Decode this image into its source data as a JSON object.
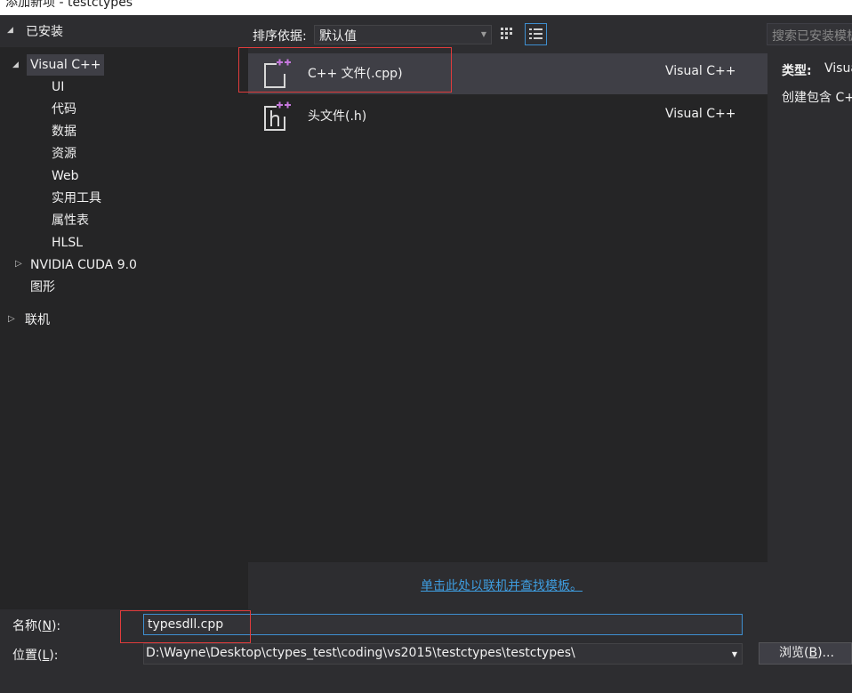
{
  "window": {
    "title": "添加新项 - testctypes"
  },
  "tree": {
    "installed_label": "已安装",
    "nodes": [
      {
        "label": "Visual C++",
        "selected": true
      },
      {
        "label": "UI"
      },
      {
        "label": "代码"
      },
      {
        "label": "数据"
      },
      {
        "label": "资源"
      },
      {
        "label": "Web"
      },
      {
        "label": "实用工具"
      },
      {
        "label": "属性表"
      },
      {
        "label": "HLSL"
      },
      {
        "label": "NVIDIA CUDA 9.0"
      },
      {
        "label": "图形"
      }
    ],
    "online_label": "联机"
  },
  "toolbar": {
    "sort_label": "排序依据:",
    "sort_value": "默认值",
    "search_placeholder": "搜索已安装模板"
  },
  "templates": [
    {
      "name": "C++ 文件(.cpp)",
      "language": "Visual C++",
      "icon": "cpp-file-icon"
    },
    {
      "name": "头文件(.h)",
      "language": "Visual C++",
      "icon": "header-file-icon"
    }
  ],
  "details": {
    "type_label": "类型:",
    "type_value": "Visual C++",
    "description": "创建包含 C++ 源代码的文件"
  },
  "online_link": "单击此处以联机并查找模板。",
  "form": {
    "name_label": "名称(",
    "name_key": "N",
    "name_suffix": "):",
    "name_value": "typesdll.cpp",
    "location_label": "位置(",
    "location_key": "L",
    "location_suffix": "):",
    "location_value": "D:\\Wayne\\Desktop\\ctypes_test\\coding\\vs2015\\testctypes\\testctypes\\",
    "browse_label": "浏览(",
    "browse_key": "B",
    "browse_suffix": ")..."
  },
  "colors": {
    "accent": "#3e8fd0",
    "highlight_box": "#e03c3c",
    "link": "#3e9cde"
  }
}
